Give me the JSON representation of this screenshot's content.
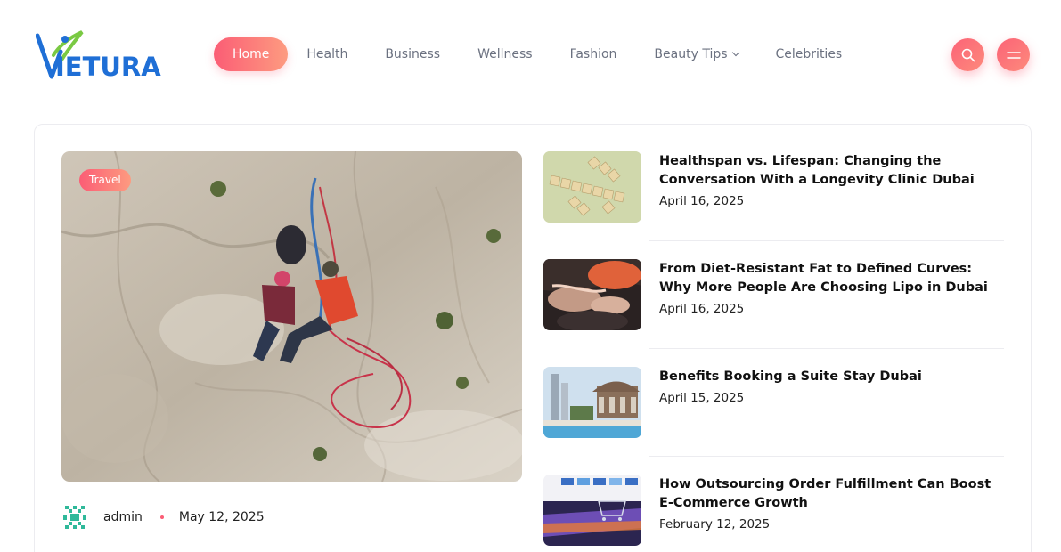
{
  "brand": {
    "name": "IETURA",
    "accent": "#fb5d75",
    "accent_light": "#fd9b80",
    "logo_blue": "#1f6fd6",
    "logo_green": "#7ac943"
  },
  "nav": {
    "items": [
      {
        "label": "Home",
        "active": true
      },
      {
        "label": "Health"
      },
      {
        "label": "Business"
      },
      {
        "label": "Wellness"
      },
      {
        "label": "Fashion"
      },
      {
        "label": "Beauty Tips",
        "has_dropdown": true
      },
      {
        "label": "Celebrities"
      }
    ]
  },
  "header_actions": {
    "search_icon": "search-icon",
    "menu_icon": "hamburger-menu-icon"
  },
  "featured": {
    "tag": "Travel",
    "author": "admin",
    "date": "May 12, 2025"
  },
  "posts": [
    {
      "title": "Healthspan vs. Lifespan: Changing the Conversation With a Longevity Clinic Dubai",
      "date": "April 16, 2025"
    },
    {
      "title": "From Diet-Resistant Fat to Defined Curves: Why More People Are Choosing Lipo in Dubai",
      "date": "April 16, 2025"
    },
    {
      "title": "Benefits Booking a Suite Stay Dubai",
      "date": "April 15, 2025"
    },
    {
      "title": "How Outsourcing Order Fulfillment Can Boost E-Commerce Growth",
      "date": "February 12, 2025"
    }
  ]
}
